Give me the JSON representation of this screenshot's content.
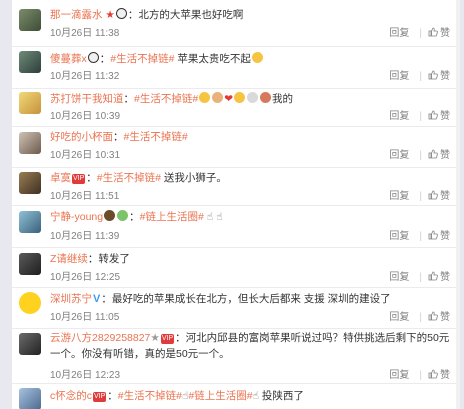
{
  "comments": [
    {
      "name": "那一滴露水",
      "text": "：北方的大苹果也好吃啊",
      "time": "10月26日 11:38",
      "reply": "回复",
      "like": "赞"
    },
    {
      "name": "傻蔓葬x",
      "text": "：",
      "tag": "#生活不掉链#",
      "text2": " 苹果太贵吃不起",
      "time": "10月26日 11:32",
      "reply": "回复",
      "like": "赞"
    },
    {
      "name": "苏打饼干我知道",
      "text": "：",
      "tag": "#生活不掉链#",
      "text2": "我的",
      "time": "10月26日 10:39",
      "reply": "回复",
      "like": "赞"
    },
    {
      "name": "好吃的小杯面",
      "text": "：",
      "tag": "#生活不掉链#",
      "time": "10月26日 10:31",
      "reply": "回复",
      "like": "赞"
    },
    {
      "name": "卓寞",
      "text": "：",
      "tag": "#生活不掉链#",
      "text2": " 送我小狮子。",
      "time": "10月26日 11:51",
      "reply": "回复",
      "like": "赞"
    },
    {
      "name": "宁静-young",
      "text": "：",
      "tag": "#链上生活圈#",
      "time": "10月26日 11:39",
      "reply": "回复",
      "like": "赞"
    },
    {
      "name": "Z请继续",
      "text": "：转发了",
      "time": "10月26日 12:25",
      "reply": "回复",
      "like": "赞"
    },
    {
      "name": "深圳苏宁",
      "text": "：最好吃的苹果成长在北方，但长大后都来 支援 深圳的建设了",
      "time": "10月26日 11:05",
      "reply": "回复",
      "like": "赞"
    },
    {
      "name": "云游八方2829258827",
      "text": "：河北内邱县的富岗苹果听说过吗？特供挑选后剩下的50元一个。你没有听错，真的是50元一个。",
      "time": "10月26日 12:23",
      "reply": "回复",
      "like": "赞"
    },
    {
      "name": "c怀念的c",
      "text": "：",
      "tag": "#生活不掉链#",
      "tag2": "#链上生活圈#",
      "text2": " 投陕西了"
    }
  ],
  "colors": {
    "name": "#eb7350",
    "text": "#333333",
    "time": "#808080",
    "divider": "#ebebeb"
  }
}
